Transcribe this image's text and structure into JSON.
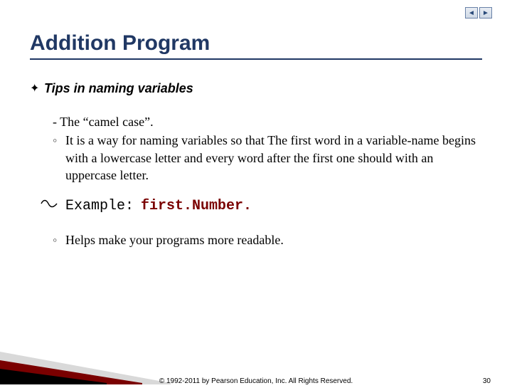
{
  "nav": {
    "prev": "◄",
    "next": "►"
  },
  "title": "Addition Program",
  "subhead": "Tips in naming variables",
  "subhead_bullet": "✦",
  "item1_head": "- The “camel case”.",
  "item1_sub_bullet": "◦",
  "item1_sub": "It is a way for naming variables so that The first word in a variable-name begins with a lowercase letter and every word after the first one should with an uppercase letter.",
  "example_label": "Example:",
  "example_value": "first.Number.",
  "item2_bullet": "◦",
  "item2": "Helps make your programs more readable.",
  "copyright": "© 1992-2011 by Pearson Education, Inc. All Rights Reserved.",
  "page": "30"
}
